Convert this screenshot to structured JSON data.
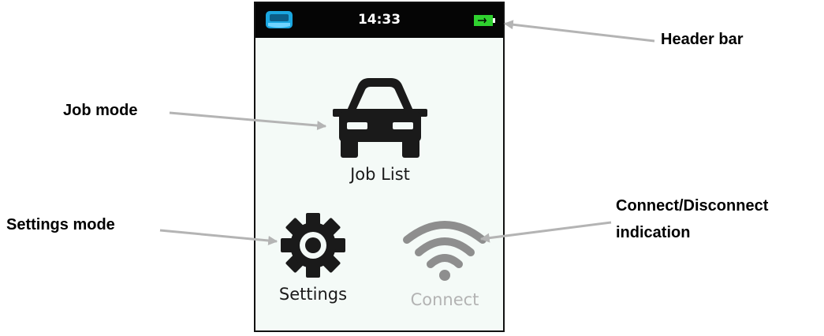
{
  "device": {
    "header": {
      "time": "14:33",
      "logo_icon": "brand-logo-icon",
      "battery_icon": "battery-charging-icon"
    },
    "tiles": [
      {
        "label": "Job List",
        "icon": "car-icon"
      },
      {
        "label": "Settings",
        "icon": "gear-icon"
      },
      {
        "label": "Connect",
        "icon": "wifi-icon",
        "state": "disconnected"
      }
    ]
  },
  "callouts": {
    "header_bar": "Header bar",
    "job_mode": "Job mode",
    "settings_mode": "Settings mode",
    "connect_line1": "Connect/Disconnect",
    "connect_line2": "indication"
  },
  "colors": {
    "header_bg": "#050505",
    "screen_bg": "#f4faf7",
    "logo_blue": "#1aa6e0",
    "battery_green": "#2fd12f",
    "icon_dark": "#1a1a1a",
    "connect_inactive": "#8e8e8e",
    "arrow": "#b4b4b4"
  }
}
